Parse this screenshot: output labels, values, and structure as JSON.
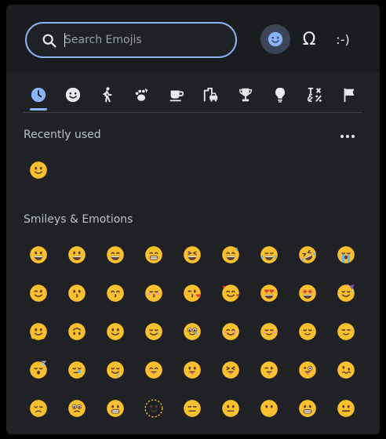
{
  "search": {
    "placeholder": "Search Emojis"
  },
  "modes": [
    {
      "name": "emoji",
      "icon": "smile-icon",
      "active": true
    },
    {
      "name": "symbols",
      "label": "Ω"
    },
    {
      "name": "emoticons",
      "label": ":-)"
    }
  ],
  "categories": [
    {
      "name": "recently-used",
      "icon": "clock-icon",
      "active": true
    },
    {
      "name": "smileys",
      "icon": "smile-icon"
    },
    {
      "name": "people",
      "icon": "person-walking-icon"
    },
    {
      "name": "animals",
      "icon": "paw-icon"
    },
    {
      "name": "food",
      "icon": "coffee-icon"
    },
    {
      "name": "travel",
      "icon": "city-car-icon"
    },
    {
      "name": "activities",
      "icon": "trophy-icon"
    },
    {
      "name": "objects",
      "icon": "lightbulb-icon"
    },
    {
      "name": "symbols",
      "icon": "symbols-icon"
    },
    {
      "name": "flags",
      "icon": "flag-icon"
    }
  ],
  "recent": {
    "title": "Recently used",
    "emojis": [
      "🙂"
    ]
  },
  "smileys": {
    "title": "Smileys & Emotions",
    "emojis": [
      "😀",
      "😃",
      "😄",
      "😁",
      "😆",
      "😅",
      "😂",
      "🤣",
      "😭",
      "😉",
      "😗",
      "😙",
      "😚",
      "😘",
      "🥰",
      "😍",
      "🤩",
      "🥳",
      "🫠",
      "🙃",
      "🙂",
      "🥲",
      "🥹",
      "😊",
      "☺️",
      "😌",
      "😏",
      "😴",
      "😪",
      "🤤",
      "😋",
      "😛",
      "😝",
      "😜",
      "🤪",
      "🥴",
      "😔",
      "🥺",
      "😬",
      "🫥",
      "😑",
      "😐",
      "😶",
      "🫨",
      "🤐"
    ]
  },
  "colors": {
    "accent": "#8ab4f8",
    "panel": "#202124",
    "face": "#fbc02d"
  }
}
